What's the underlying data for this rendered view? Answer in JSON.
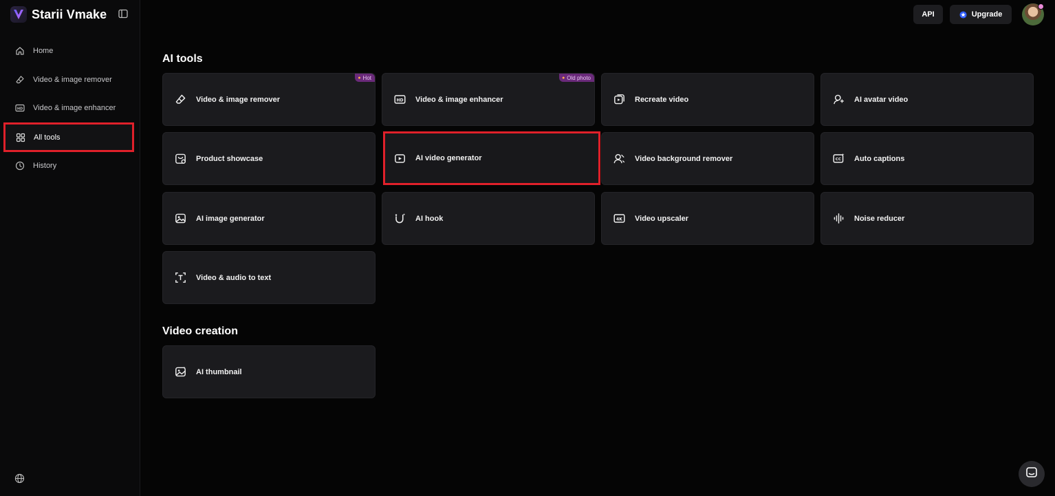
{
  "brand": {
    "name": "Starii Vmake"
  },
  "sidebar": {
    "items": [
      {
        "label": "Home",
        "icon": "home-icon"
      },
      {
        "label": "Video & image remover",
        "icon": "eraser-icon"
      },
      {
        "label": "Video & image enhancer",
        "icon": "hd-icon"
      },
      {
        "label": "All tools",
        "icon": "grid-icon",
        "active": true
      },
      {
        "label": "History",
        "icon": "clock-icon"
      }
    ]
  },
  "topbar": {
    "api_label": "API",
    "upgrade_label": "Upgrade"
  },
  "sections": {
    "ai_tools": {
      "title": "AI tools",
      "cards": [
        {
          "label": "Video & image remover",
          "icon": "eraser-icon",
          "badge": "Hot"
        },
        {
          "label": "Video & image enhancer",
          "icon": "hd-icon",
          "badge": "Old photo"
        },
        {
          "label": "Recreate video",
          "icon": "recreate-icon"
        },
        {
          "label": "AI avatar video",
          "icon": "avatar-video-icon"
        },
        {
          "label": "Product showcase",
          "icon": "product-icon"
        },
        {
          "label": "AI video generator",
          "icon": "play-icon",
          "highlighted": true
        },
        {
          "label": "Video background remover",
          "icon": "bg-remover-icon"
        },
        {
          "label": "Auto captions",
          "icon": "cc-icon"
        },
        {
          "label": "AI image generator",
          "icon": "image-icon"
        },
        {
          "label": "AI hook",
          "icon": "hook-icon"
        },
        {
          "label": "Video upscaler",
          "icon": "4k-icon"
        },
        {
          "label": "Noise reducer",
          "icon": "waveform-icon"
        },
        {
          "label": "Video & audio to text",
          "icon": "text-icon"
        }
      ]
    },
    "video_creation": {
      "title": "Video creation",
      "cards": [
        {
          "label": "AI thumbnail",
          "icon": "thumbnail-icon"
        }
      ]
    }
  },
  "colors": {
    "highlight": "#e0202a",
    "badge_bg": "#6a2a7a",
    "card_bg": "#1b1b1e",
    "page_bg": "#050505"
  }
}
